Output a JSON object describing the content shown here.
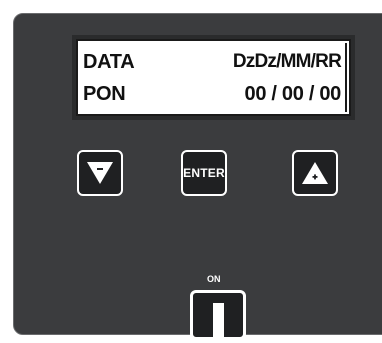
{
  "display": {
    "row1_label": "DATA",
    "row1_value": "DzDz/MM/RR",
    "row2_label": "PON",
    "row2_value": "00 / 00 / 00"
  },
  "buttons": {
    "down_icon": "triangle-down-minus-icon",
    "enter_label": "ENTER",
    "up_icon": "triangle-up-plus-icon"
  },
  "power": {
    "on_label": "ON"
  },
  "colors": {
    "panel": "#3b3c3e",
    "button_bg": "#1f2022",
    "button_border": "#ffffff",
    "lcd_bg": "#ffffff"
  }
}
